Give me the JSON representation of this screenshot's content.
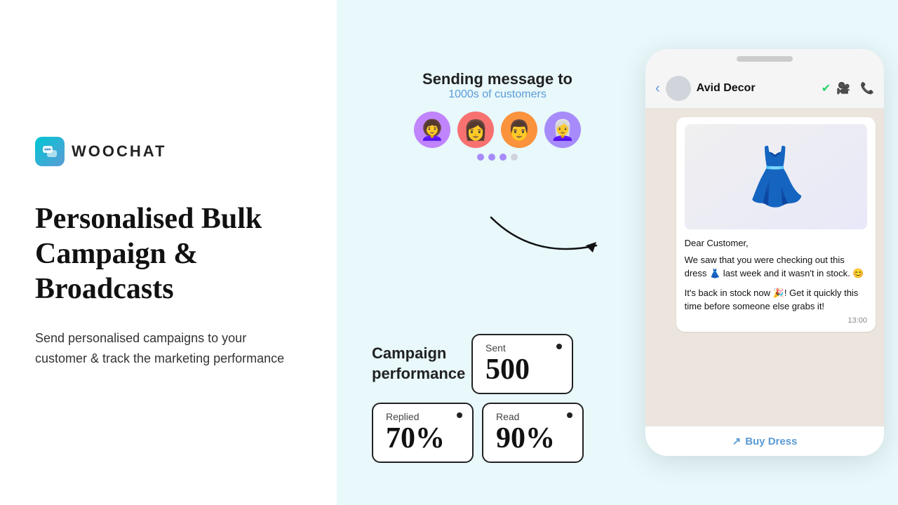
{
  "logo": {
    "icon": "💬",
    "text": "WOOCHAT"
  },
  "headline": "Personalised Bulk Campaign & Broadcasts",
  "subtext": "Send personalised campaigns to your customer & track the marketing performance",
  "sending": {
    "title": "Sending message to",
    "subtitle": "1000s of customers"
  },
  "avatars": [
    {
      "emoji": "👩‍🦱",
      "bg": "#c084fc"
    },
    {
      "emoji": "👩",
      "bg": "#f87171"
    },
    {
      "emoji": "👨",
      "bg": "#fb923c"
    },
    {
      "emoji": "👩‍🦳",
      "bg": "#a78bfa"
    }
  ],
  "campaign_label": "Campaign performance",
  "stats": {
    "sent": {
      "label": "Sent",
      "value": "500"
    },
    "replied": {
      "label": "Replied",
      "value": "70%"
    },
    "read": {
      "label": "Read",
      "value": "90%"
    }
  },
  "phone": {
    "contact_name": "Avid Decor",
    "message_line1": "Dear Customer,",
    "message_line2": "We saw that you were checking out this dress 👗 last week and it wasn't in stock. 😊",
    "message_line3": "It's back in stock now 🎉! Get it quickly this time before someone else grabs it!",
    "time": "13:00",
    "buy_label": "Buy Dress"
  }
}
